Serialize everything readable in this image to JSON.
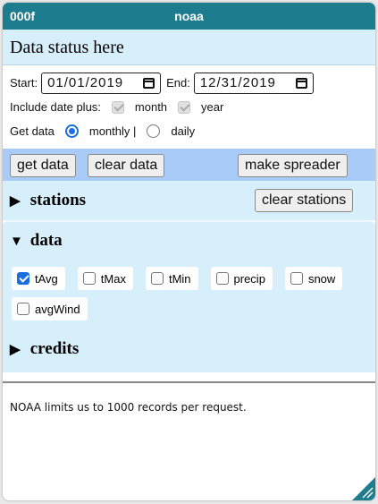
{
  "window": {
    "title_left": "000f",
    "title": "noaa"
  },
  "status": {
    "text": "Data status here"
  },
  "params": {
    "start_label": "Start:",
    "start_value": "01/01/2019",
    "end_label": "End:",
    "end_value": "12/31/2019",
    "include_label": "Include date plus:",
    "month_label": "month",
    "year_label": "year",
    "getdata_label": "Get data",
    "monthly_label": "monthly |",
    "daily_label": "daily"
  },
  "toolbar": {
    "get_data": "get data",
    "clear_data": "clear data",
    "make_spreader": "make spreader"
  },
  "stations": {
    "triangle": "▶",
    "label": "stations",
    "clear_button": "clear stations"
  },
  "data_section": {
    "triangle": "▼",
    "label": "data",
    "attributes": [
      {
        "label": "tAvg",
        "checked": true
      },
      {
        "label": "tMax",
        "checked": false
      },
      {
        "label": "tMin",
        "checked": false
      },
      {
        "label": "precip",
        "checked": false
      },
      {
        "label": "snow",
        "checked": false
      },
      {
        "label": "avgWind",
        "checked": false
      }
    ]
  },
  "credits": {
    "triangle": "▶",
    "label": "credits"
  },
  "footer": {
    "note": "NOAA limits us to 1000 records per request."
  },
  "colors": {
    "titlebar": "#1d7d8f",
    "panel": "#d7eefb",
    "toolbar": "#a9cbf7",
    "accent": "#1a6fe0"
  }
}
